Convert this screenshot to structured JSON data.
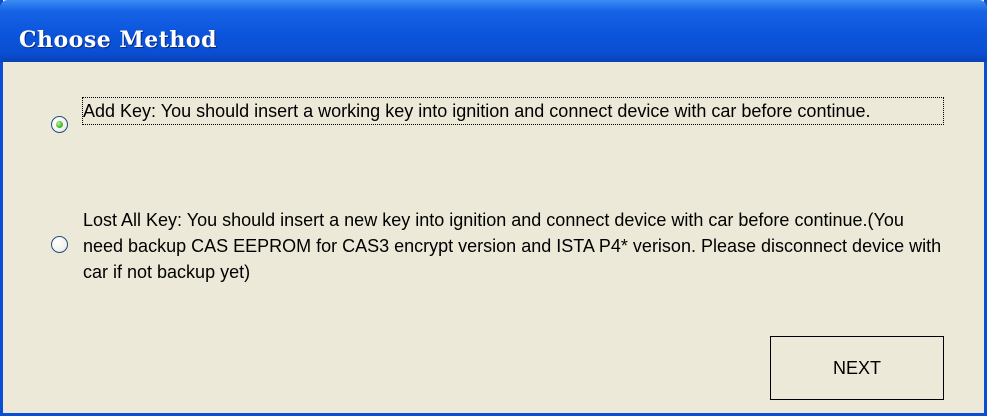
{
  "window": {
    "title": "Choose Method"
  },
  "options": [
    {
      "label": "Add Key: You should insert a working key into ignition and connect device with car before continue.",
      "selected": true
    },
    {
      "label": "Lost All Key: You should insert a new key into ignition and connect device with car before continue.(You need backup CAS EEPROM for CAS3 encrypt version and ISTA P4* verison. Please disconnect device with car if not backup yet)",
      "selected": false
    }
  ],
  "buttons": {
    "next_label": "NEXT"
  },
  "colors": {
    "title_bar": "#0a55dc",
    "window_body": "#ece9d8",
    "radio_selected": "#39b31d"
  }
}
